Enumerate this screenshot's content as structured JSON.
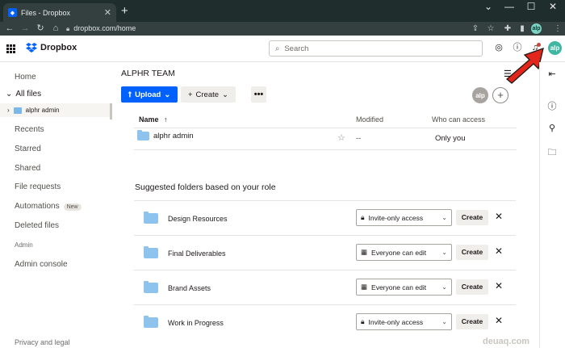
{
  "browser": {
    "tab_title": "Files - Dropbox",
    "tab_close": "✕",
    "new_tab": "+",
    "url": "dropbox.com/home",
    "profile_initials": "alp",
    "window": {
      "min": "⌄",
      "minimize": "—",
      "maximize": "☐",
      "close": "✕"
    }
  },
  "header": {
    "logo_text": "Dropbox",
    "search_placeholder": "Search",
    "avatar_initials": "alp",
    "brand_color": "#0061fe",
    "arrow_color": "#e3261c"
  },
  "sidebar": {
    "home": "Home",
    "all_files": "All files",
    "tree_item": "alphr admin",
    "recents": "Recents",
    "starred": "Starred",
    "shared": "Shared",
    "file_requests": "File requests",
    "automations": "Automations",
    "automations_badge": "New",
    "deleted_files": "Deleted files",
    "admin_label": "Admin",
    "admin_console": "Admin console",
    "privacy": "Privacy and legal"
  },
  "main": {
    "team_title": "ALPHR TEAM",
    "upload_label": "Upload",
    "create_label": "Create",
    "more_label": "•••",
    "team_avatar": "alp",
    "add_member": "+",
    "columns": {
      "name": "Name",
      "name_sort": "↑",
      "modified": "Modified",
      "who": "Who can access"
    },
    "rows": [
      {
        "name": "alphr admin",
        "modified": "--",
        "access": "Only you"
      }
    ],
    "suggested_title": "Suggested folders based on your role",
    "create_button": "Create",
    "suggested": [
      {
        "name": "Design Resources",
        "permission": "Invite-only access",
        "perm_icon": "lock-icon"
      },
      {
        "name": "Final Deliverables",
        "permission": "Everyone can edit",
        "perm_icon": "building-icon"
      },
      {
        "name": "Brand Assets",
        "permission": "Everyone can edit",
        "perm_icon": "building-icon"
      },
      {
        "name": "Work in Progress",
        "permission": "Invite-only access",
        "perm_icon": "lock-icon"
      }
    ]
  },
  "watermark": "deuaq.com"
}
